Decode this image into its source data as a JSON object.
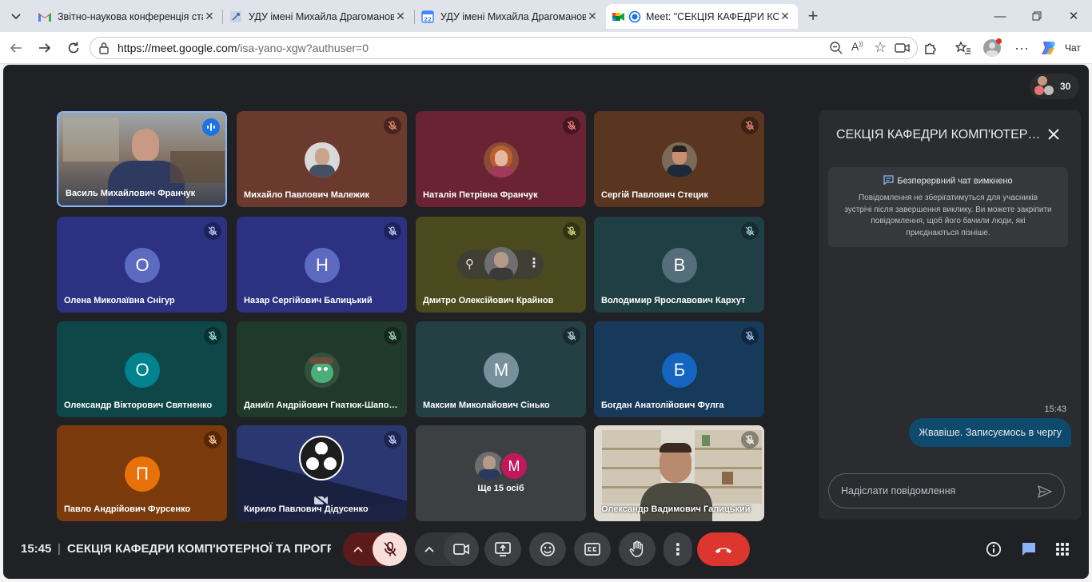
{
  "browser": {
    "tabs": [
      {
        "title": "Звітно-наукова конференція ста",
        "favicon": "gmail-icon",
        "active": false
      },
      {
        "title": "УДУ імені Михайла Драгоманова",
        "favicon": "link-icon",
        "active": false
      },
      {
        "title": "УДУ імені Михайла Драгоманова",
        "favicon": "calendar-icon",
        "active": false
      },
      {
        "title": "Meet: \"СЕКЦІЯ КАФЕДРИ КОМ",
        "favicon": "meet-icon",
        "active": true
      }
    ],
    "url_host": "https://meet.google.com",
    "url_path": "/isa-yano-xgw?authuser=0",
    "copilot_label": "Чат"
  },
  "meet": {
    "participant_count": "30",
    "tiles": [
      {
        "name": "Василь Михайлович Франчук",
        "type": "video",
        "speaking": true
      },
      {
        "name": "Михайло Павлович Малежик",
        "type": "photo",
        "bg": "#6b3a2e",
        "avatar_bg": "#d9d9d9"
      },
      {
        "name": "Наталія Петрівна Франчук",
        "type": "photo",
        "bg": "#6a2332",
        "avatar_bg": "#b0624a"
      },
      {
        "name": "Сергій Павлович Стецик",
        "type": "photo",
        "bg": "#5a3620",
        "avatar_bg": "#6e5a4a"
      },
      {
        "name": "Олена Миколаївна Снігур",
        "type": "letter",
        "letter": "О",
        "bg": "#2c3281",
        "avatar_bg": "#5c6bc0"
      },
      {
        "name": "Назар Сергійович Балицький",
        "type": "letter",
        "letter": "Н",
        "bg": "#2c3281",
        "avatar_bg": "#5c6bc0"
      },
      {
        "name": "Дмитро Олексійович Крайнов",
        "type": "photo-hover",
        "bg": "#4a4a1e",
        "avatar_bg": "#707070"
      },
      {
        "name": "Володимир Ярославович Кархут",
        "type": "letter",
        "letter": "В",
        "bg": "#1f3f45",
        "avatar_bg": "#546e7a"
      },
      {
        "name": "Олександр Вікторович Святненко",
        "type": "letter",
        "letter": "О",
        "bg": "#0f4748",
        "avatar_bg": "#00838f"
      },
      {
        "name": "Даниїл Андрійович Гнатюк-Шапо…",
        "type": "photo",
        "bg": "#1f3a2a",
        "avatar_bg": "#3a5a3a"
      },
      {
        "name": "Максим Миколайович Сінько",
        "type": "letter",
        "letter": "М",
        "bg": "#244044",
        "avatar_bg": "#78909c"
      },
      {
        "name": "Богдан Анатолійович Фулга",
        "type": "letter",
        "letter": "Б",
        "bg": "#173a5a",
        "avatar_bg": "#1565c0"
      },
      {
        "name": "Павло Андрійович Фурсенко",
        "type": "letter",
        "letter": "П",
        "bg": "#7a3a0c",
        "avatar_bg": "#e8710a"
      },
      {
        "name": "Кирило Павлович Дідусенко",
        "type": "obs",
        "bg": "#1c2345"
      },
      {
        "name": "Ще 15 осіб",
        "type": "more",
        "bg": "#3c4043",
        "letter": "М"
      },
      {
        "name": "Олександр Вадимович Галицький",
        "type": "video2"
      }
    ],
    "chat": {
      "title": "СЕКЦІЯ КАФЕДРИ КОМП'ЮТЕР…",
      "notice_title": "Безперервний чат вимкнено",
      "notice_body": "Повідомлення не зберігатимуться для учасників зустрічі після завершення виклику. Ви можете закріпити повідомлення, щоб його бачили люди, які приєднаються пізніше.",
      "message_time": "15:43",
      "message_text": "Жвавіше. Записуємось в чергу",
      "input_placeholder": "Надіслати повідомлення"
    },
    "footer": {
      "time": "15:45",
      "separator": "|",
      "meeting_title": "СЕКЦІЯ КАФЕДРИ КОМП'ЮТЕРНОЇ ТА ПРОГР…"
    }
  }
}
